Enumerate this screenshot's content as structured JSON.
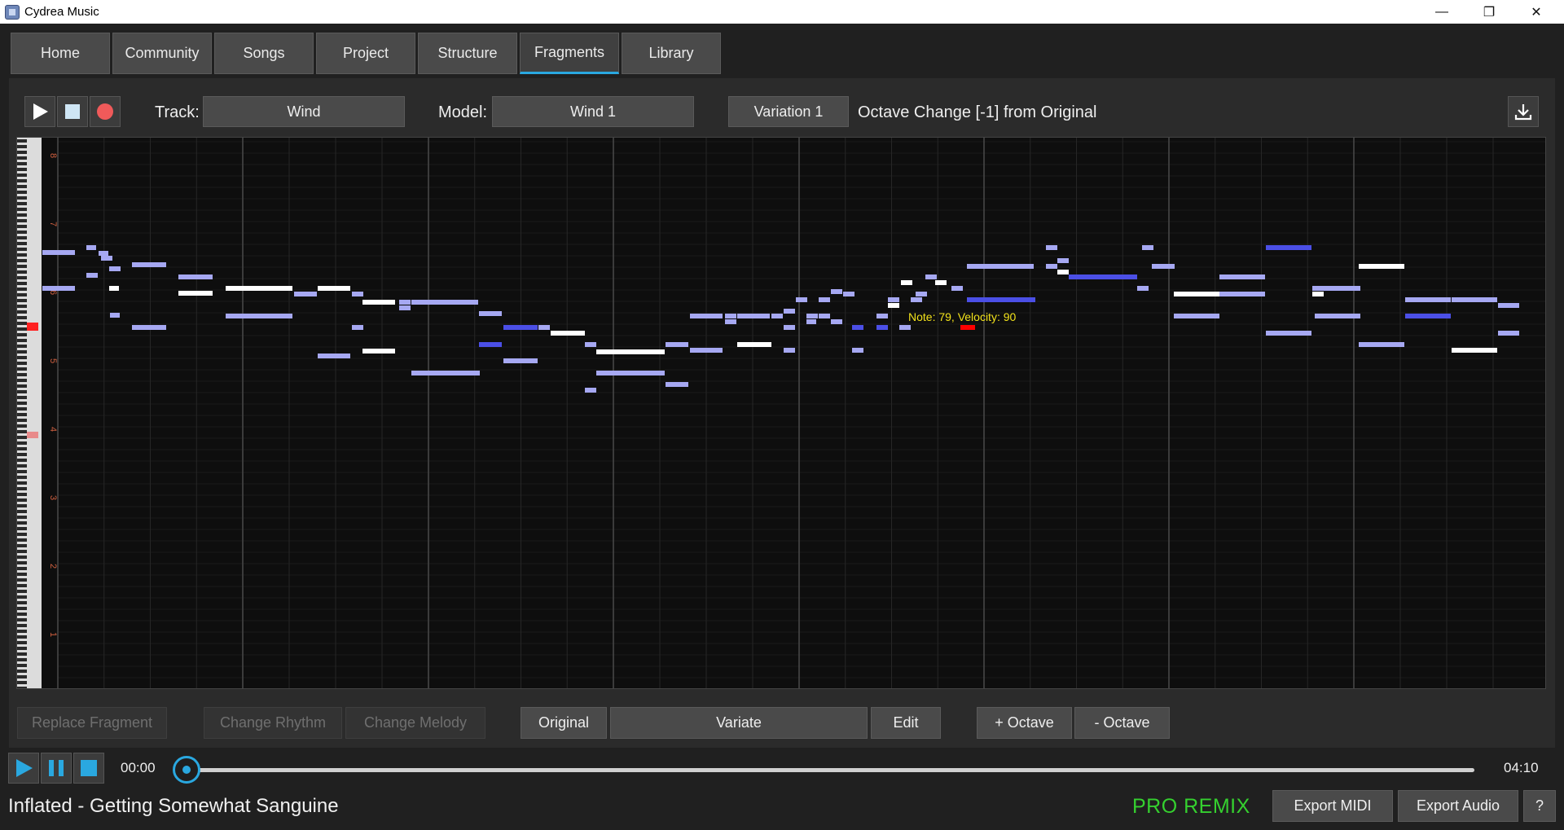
{
  "window": {
    "title": "Cydrea Music",
    "minimize": "—",
    "maximize": "❐",
    "close": "✕"
  },
  "tabs": [
    {
      "label": "Home"
    },
    {
      "label": "Community"
    },
    {
      "label": "Songs"
    },
    {
      "label": "Project"
    },
    {
      "label": "Structure"
    },
    {
      "label": "Fragments",
      "active": true
    },
    {
      "label": "Library"
    }
  ],
  "toolbar": {
    "track_label": "Track:",
    "track_value": "Wind",
    "model_label": "Model:",
    "model_value": "Wind 1",
    "variation_button": "Variation 1",
    "variation_desc": "Octave Change [-1] from Original"
  },
  "piano_roll": {
    "octave_labels": [
      "8",
      "7",
      "6",
      "5",
      "4",
      "3",
      "2",
      "1"
    ],
    "tooltip": "Note: 79, Velocity: 90",
    "colors": {
      "light_note": "#a6a8f2",
      "white_note": "#ffffff",
      "blue_note": "#4b4fe6",
      "highlight_note": "#ff0000",
      "tooltip_text": "#f2e21b",
      "octave_label": "#d06040"
    }
  },
  "actions": {
    "replace_fragment": "Replace Fragment",
    "change_rhythm": "Change Rhythm",
    "change_melody": "Change Melody",
    "original": "Original",
    "variate": "Variate",
    "edit": "Edit",
    "plus_octave": "+ Octave",
    "minus_octave": "- Octave"
  },
  "player": {
    "current_time": "00:00",
    "total_time": "04:10",
    "progress": 0.0,
    "song_title": "Inflated - Getting Somewhat Sanguine",
    "pro_label": "PRO REMIX",
    "export_midi": "Export MIDI",
    "export_audio": "Export Audio",
    "help": "?"
  },
  "colors": {
    "accent": "#2aa8e0",
    "pro": "#35d02f"
  }
}
